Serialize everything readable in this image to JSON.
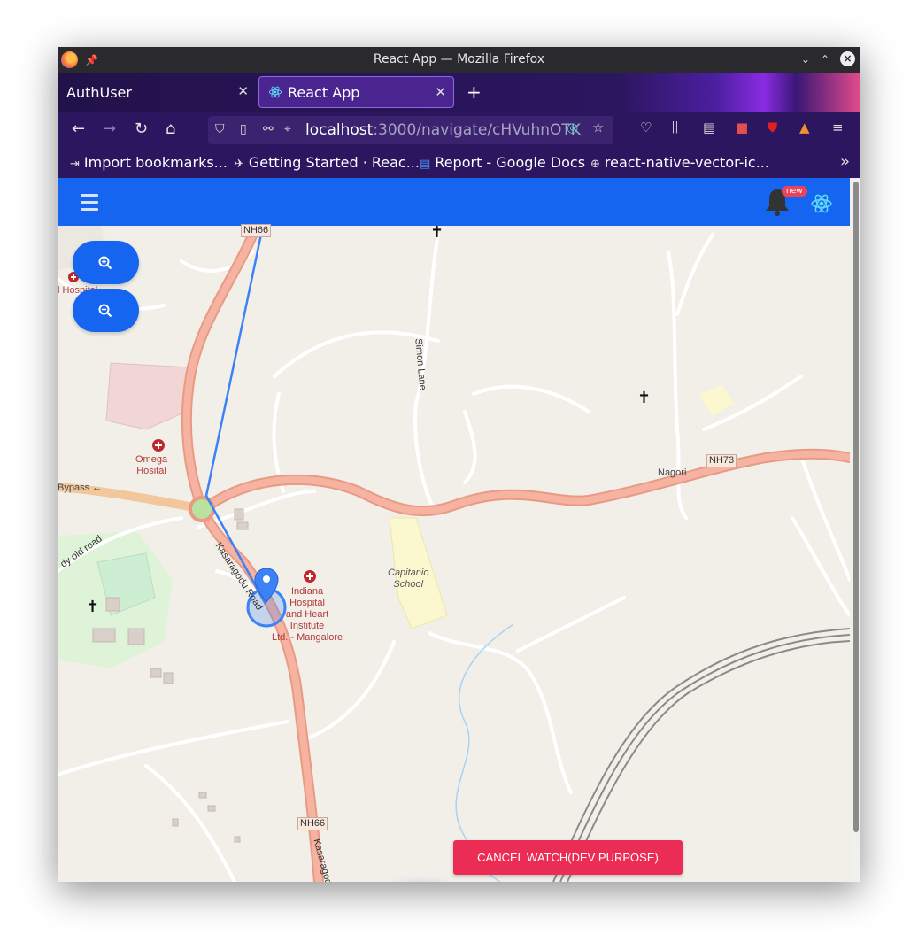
{
  "window": {
    "title": "React App — Mozilla Firefox"
  },
  "tabs": [
    {
      "label": "AuthUser"
    },
    {
      "label": "React App"
    }
  ],
  "url": {
    "host": "localhost",
    "path": ":3000/navigate/cHVuhnOTK"
  },
  "bookmarks": [
    {
      "label": "Import bookmarks..."
    },
    {
      "label": "Getting Started · Reac..."
    },
    {
      "label": "Report - Google Docs"
    },
    {
      "label": "react-native-vector-ic..."
    }
  ],
  "header": {
    "badge": "new"
  },
  "map": {
    "roads": {
      "nh66_top": "NH66",
      "nh66_bottom": "NH66",
      "nh73": "NH73",
      "bypass": "Bypass ←",
      "kasaragodu_road": "Kasaragodu Road",
      "kasaragod_bottom": "Kasaragod",
      "simon_lane": "Simon Lane",
      "old_road": "dy old road"
    },
    "places": {
      "omega": "Omega\nHosital",
      "indiana": "Indiana\nHospital\nand Heart\nInstitute\nLtd. - Mangalore",
      "capitanio": "Capitanio\nSchool",
      "nagori": "Nagori",
      "left_hospital": "l Hospital"
    }
  },
  "actions": {
    "cancel_watch": "CANCEL WATCH(DEV PURPOSE)"
  },
  "colors": {
    "primary": "#1565f0",
    "danger": "#eb2d55",
    "route": "#3b82f6",
    "road_major": "#f0a08c"
  }
}
